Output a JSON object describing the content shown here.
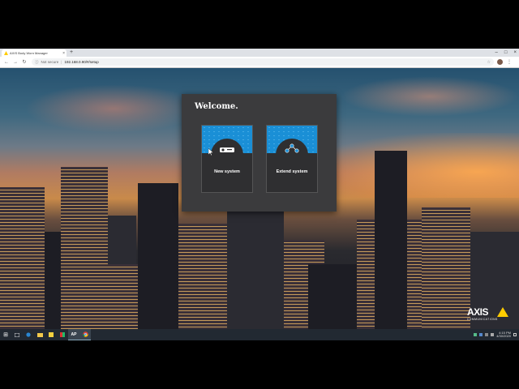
{
  "browser": {
    "tab_title": "AXIS Body Worn Manager",
    "tab_close": "×",
    "new_tab": "+",
    "window_controls": [
      "–",
      "□",
      "×"
    ],
    "nav": {
      "back": "←",
      "forward": "→",
      "reload": "↻"
    },
    "address": {
      "info": "ⓘ",
      "security": "Not secure",
      "separator": "|",
      "url": "192.168.0.90/#/setup"
    },
    "star": "☆",
    "menu": "⋮"
  },
  "dialog": {
    "title": "Welcome.",
    "cards": [
      {
        "label": "New system",
        "icon": "camera-device-icon"
      },
      {
        "label": "Extend system",
        "icon": "network-nodes-icon"
      }
    ]
  },
  "logo": {
    "brand": "AXIS",
    "sub": "COMMUNICATIONS",
    "accent": "#ffcc00"
  },
  "taskbar": {
    "start": "⊞",
    "apps": [
      "start-icon",
      "task-view-icon",
      "edge-icon",
      "file-explorer-icon",
      "sticky-notes-icon",
      "app-icon",
      "axis-app-icon",
      "chrome-icon"
    ],
    "ap_label": "AP",
    "clock_time": "4:15 PM",
    "clock_date": "4/30/2020"
  },
  "colors": {
    "card_art": "#1a8fd6",
    "dialog_bg": "#3b3b3d",
    "taskbar": "#222932"
  }
}
